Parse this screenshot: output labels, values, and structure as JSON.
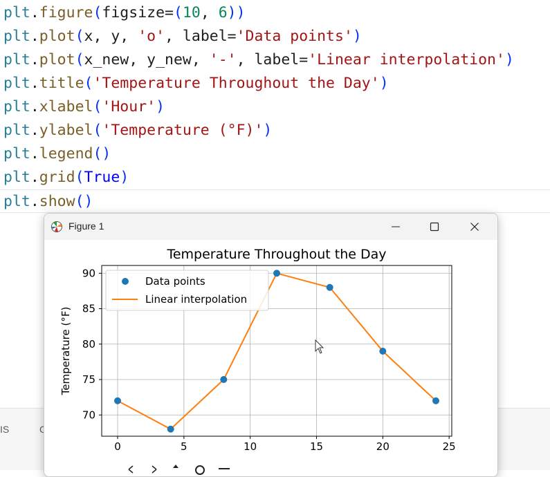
{
  "editor": {
    "lines": [
      [
        [
          "t-mod",
          "plt"
        ],
        [
          "t-txt",
          "."
        ],
        [
          "t-fn",
          "figure"
        ],
        [
          "t-punc",
          "("
        ],
        [
          "t-txt",
          "figsize"
        ],
        [
          "t-txt",
          "="
        ],
        [
          "t-punc",
          "("
        ],
        [
          "t-num",
          "10"
        ],
        [
          "t-txt",
          ", "
        ],
        [
          "t-num",
          "6"
        ],
        [
          "t-punc",
          "))"
        ]
      ],
      [
        [
          "t-mod",
          "plt"
        ],
        [
          "t-txt",
          "."
        ],
        [
          "t-fn",
          "plot"
        ],
        [
          "t-punc",
          "("
        ],
        [
          "t-txt",
          "x, y, "
        ],
        [
          "t-str",
          "'o'"
        ],
        [
          "t-txt",
          ", label="
        ],
        [
          "t-str",
          "'Data points'"
        ],
        [
          "t-punc",
          ")"
        ]
      ],
      [
        [
          "t-mod",
          "plt"
        ],
        [
          "t-txt",
          "."
        ],
        [
          "t-fn",
          "plot"
        ],
        [
          "t-punc",
          "("
        ],
        [
          "t-txt",
          "x_new, y_new, "
        ],
        [
          "t-str",
          "'-'"
        ],
        [
          "t-txt",
          ", label="
        ],
        [
          "t-str",
          "'Linear interpolation'"
        ],
        [
          "t-punc",
          ")"
        ]
      ],
      [
        [
          "t-mod",
          "plt"
        ],
        [
          "t-txt",
          "."
        ],
        [
          "t-fn",
          "title"
        ],
        [
          "t-punc",
          "("
        ],
        [
          "t-str",
          "'Temperature Throughout the Day'"
        ],
        [
          "t-punc",
          ")"
        ]
      ],
      [
        [
          "t-mod",
          "plt"
        ],
        [
          "t-txt",
          "."
        ],
        [
          "t-fn",
          "xlabel"
        ],
        [
          "t-punc",
          "("
        ],
        [
          "t-str",
          "'Hour'"
        ],
        [
          "t-punc",
          ")"
        ]
      ],
      [
        [
          "t-mod",
          "plt"
        ],
        [
          "t-txt",
          "."
        ],
        [
          "t-fn",
          "ylabel"
        ],
        [
          "t-punc",
          "("
        ],
        [
          "t-str",
          "'Temperature (°F)'"
        ],
        [
          "t-punc",
          ")"
        ]
      ],
      [
        [
          "t-mod",
          "plt"
        ],
        [
          "t-txt",
          "."
        ],
        [
          "t-fn",
          "legend"
        ],
        [
          "t-punc",
          "()"
        ]
      ],
      [
        [
          "t-mod",
          "plt"
        ],
        [
          "t-txt",
          "."
        ],
        [
          "t-fn",
          "grid"
        ],
        [
          "t-punc",
          "("
        ],
        [
          "t-kw",
          "True"
        ],
        [
          "t-punc",
          ")"
        ]
      ],
      [
        [
          "t-mod",
          "plt"
        ],
        [
          "t-txt",
          "."
        ],
        [
          "t-fn",
          "show"
        ],
        [
          "t-punc",
          "()"
        ]
      ]
    ]
  },
  "bottom_panel": {
    "tab_left": "IS",
    "tab_right": "O"
  },
  "figure_window": {
    "title": "Figure 1",
    "minimize_glyph": "—",
    "maximize_glyph": "☐",
    "close_glyph": "✕"
  },
  "chart_data": {
    "type": "line",
    "title": "Temperature Throughout the Day",
    "xlabel": "",
    "ylabel": "Temperature (°F)",
    "x": [
      0,
      4,
      8,
      12,
      16,
      20,
      24
    ],
    "series": [
      {
        "name": "Data points",
        "style": "markers",
        "color": "#1f77b4",
        "values": [
          72,
          68,
          75,
          90,
          88,
          79,
          72
        ]
      },
      {
        "name": "Linear interpolation",
        "style": "line",
        "color": "#ff7f0e",
        "values": [
          72,
          68,
          75,
          90,
          88,
          79,
          72
        ]
      }
    ],
    "xticks": [
      0,
      5,
      10,
      15,
      20,
      25
    ],
    "yticks": [
      70,
      75,
      80,
      85,
      90
    ],
    "xlim": [
      -1.2,
      25.2
    ],
    "ylim": [
      67.0,
      91.1
    ],
    "grid": true,
    "legend_position": "top-left"
  }
}
